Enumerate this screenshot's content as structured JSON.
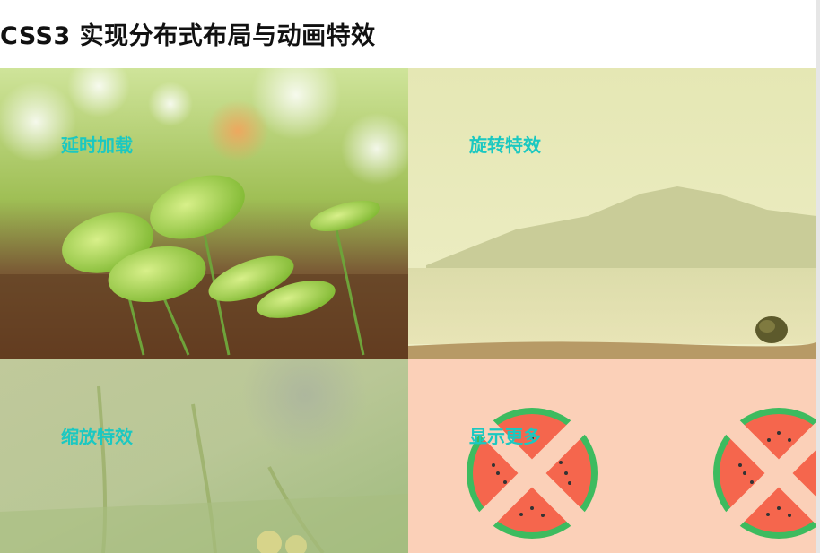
{
  "page": {
    "title": "CSS3 实现分布式布局与动画特效"
  },
  "tiles": [
    {
      "label": "延时加载",
      "image": "green-leaves-bokeh-photo"
    },
    {
      "label": "旋转特效",
      "image": "sea-mountain-coconut-photo"
    },
    {
      "label": "缩放特效",
      "image": "blurred-grass-photo"
    },
    {
      "label": "显示更多",
      "image": "watermelon-slices-illustration"
    }
  ],
  "colors": {
    "label_text": "#1bc8c1",
    "watermelon_bg": "#fbd0b8",
    "watermelon_rind": "#3dbb5f",
    "watermelon_flesh": "#f5664d"
  }
}
